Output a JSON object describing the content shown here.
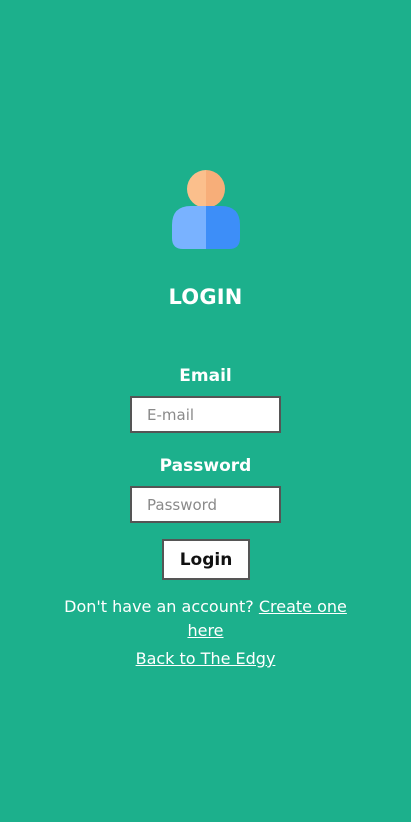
{
  "colors": {
    "background": "#1cb08c",
    "avatar_head_light": "#fbbf8c",
    "avatar_head_dark": "#f7ae79",
    "avatar_body_light": "#79b2ff",
    "avatar_body_dark": "#3d8ef8"
  },
  "icons": {
    "avatar": "user-icon"
  },
  "login_form": {
    "title": "LOGIN",
    "email": {
      "label": "Email",
      "placeholder": "E-mail",
      "value": ""
    },
    "password": {
      "label": "Password",
      "placeholder": "Password",
      "value": ""
    },
    "submit_label": "Login"
  },
  "footer": {
    "signup_prompt": "Don't have an account?",
    "signup_link": "Create one here",
    "back_link": "Back to The Edgy"
  }
}
